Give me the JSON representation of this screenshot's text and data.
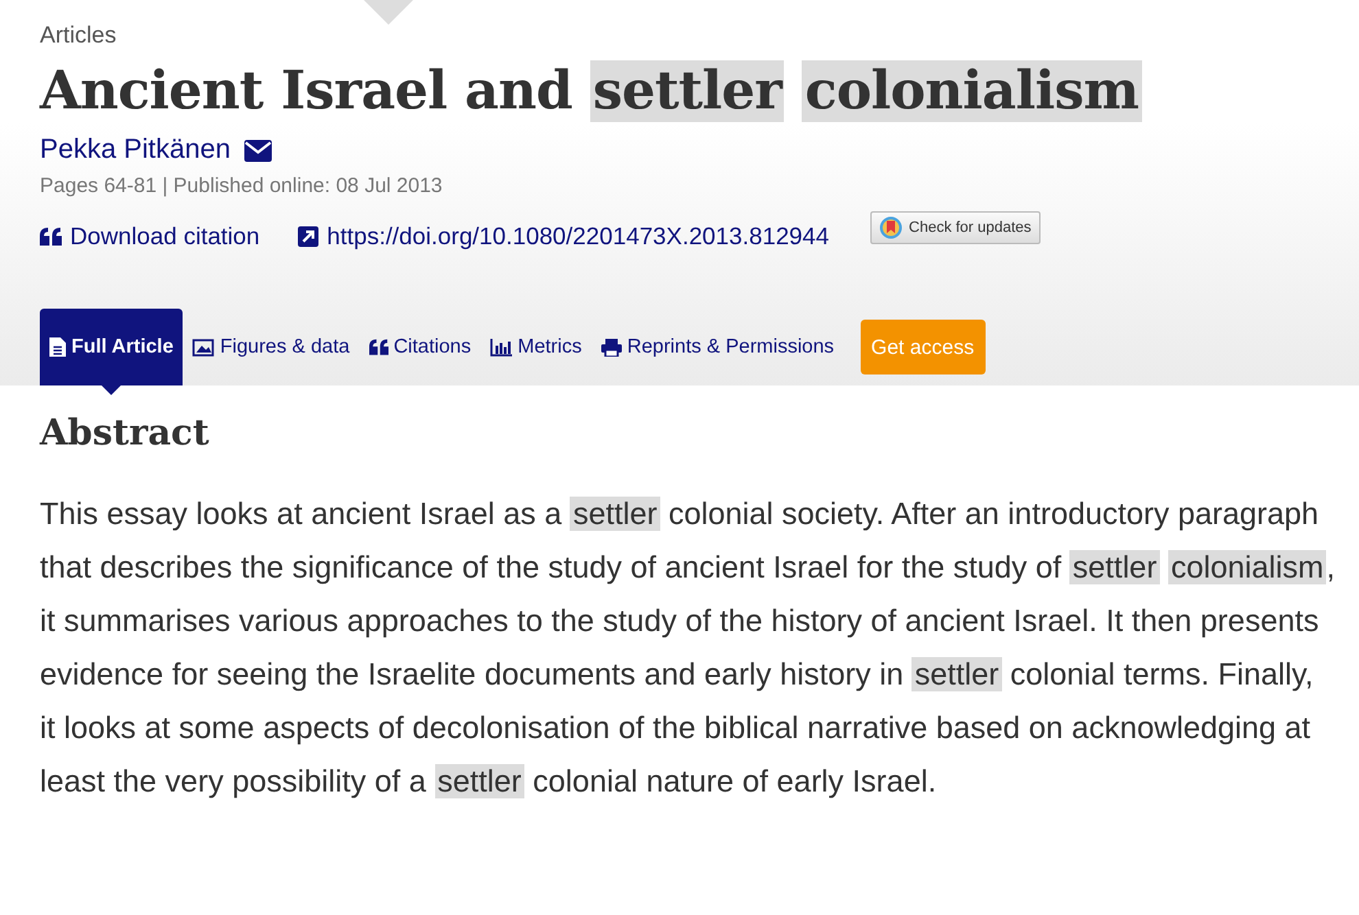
{
  "section": "Articles",
  "title": [
    {
      "text": "Ancient Israel and",
      "highlight": false
    },
    {
      "text": "settler",
      "highlight": true
    },
    {
      "text": "colonialism",
      "highlight": true
    }
  ],
  "author": {
    "name": "Pekka Pitkänen"
  },
  "meta": "Pages 64-81 | Published online: 08 Jul 2013",
  "links": [
    {
      "kind": "citation",
      "label": "Download citation"
    },
    {
      "kind": "doi",
      "label": "https://doi.org/10.1080/2201473X.2013.812944"
    }
  ],
  "updates_badge": "Check for updates",
  "tabs": [
    {
      "kind": "article",
      "label": "Full Article",
      "selected": true
    },
    {
      "kind": "figures",
      "label": "Figures & data",
      "selected": false
    },
    {
      "kind": "citations",
      "label": "Citations",
      "selected": false
    },
    {
      "kind": "metrics",
      "label": "Metrics",
      "selected": false
    },
    {
      "kind": "reprints",
      "label": "Reprints & Permissions",
      "selected": false
    }
  ],
  "access_button": "Get access",
  "abstract": {
    "heading": "Abstract",
    "segments": [
      {
        "text": "This essay looks at ancient Israel as a ",
        "highlight": false
      },
      {
        "text": "settler",
        "highlight": true
      },
      {
        "text": " colonial society. After an introductory paragraph that describes the significance of the study of ancient Israel for the study of ",
        "highlight": false
      },
      {
        "text": "settler",
        "highlight": true
      },
      {
        "text": "colonialism",
        "highlight": true
      },
      {
        "text": ", it summarises various approaches to the study of the history of ancient Israel. It then presents evidence for seeing the Israelite documents and early history in ",
        "highlight": false
      },
      {
        "text": "settler",
        "highlight": true
      },
      {
        "text": " colonial terms. Finally, it looks at some aspects of decolonisation of the biblical narrative based on acknowledging at least the very possibility of a ",
        "highlight": false
      },
      {
        "text": "settler",
        "highlight": true
      },
      {
        "text": " colonial nature of early Israel.",
        "highlight": false
      }
    ]
  }
}
